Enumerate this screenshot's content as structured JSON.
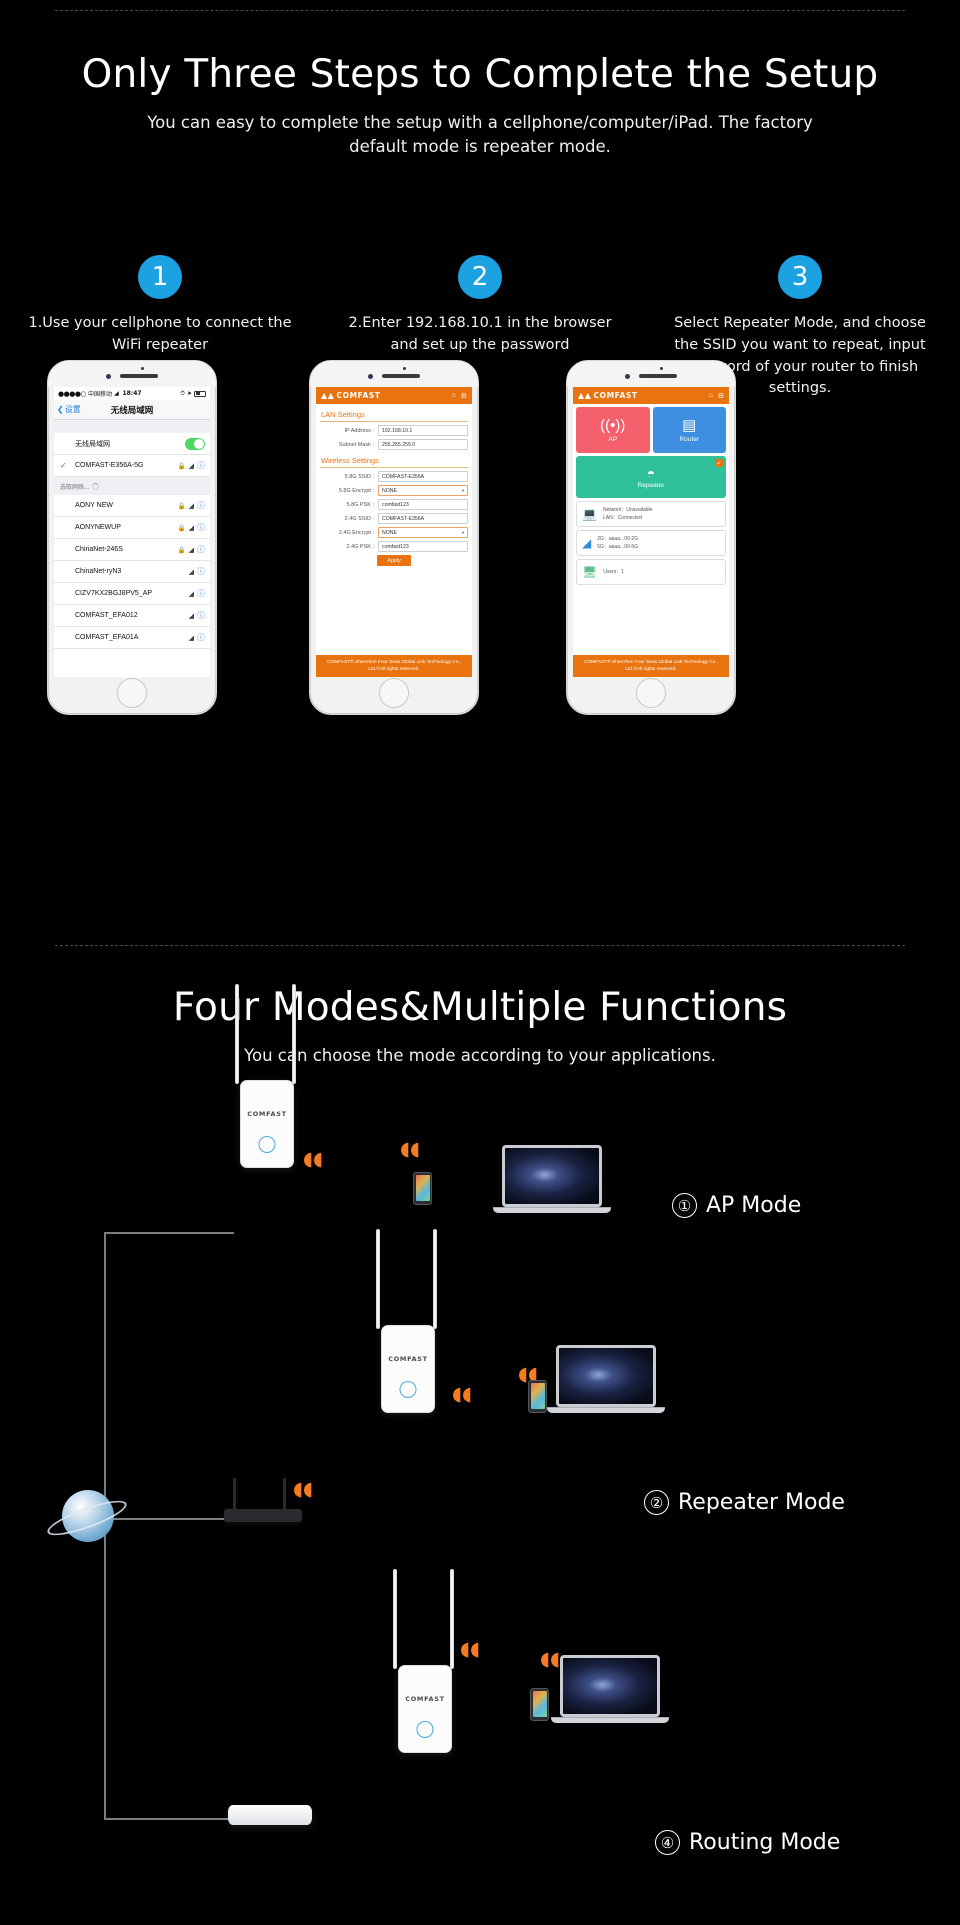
{
  "hero": {
    "title": "Only Three Steps to Complete the Setup",
    "subtitle": "You can easy to complete the setup with a cellphone/computer/iPad. The factory default mode is repeater mode."
  },
  "steps": [
    {
      "badge": "1",
      "text": "1.Use your cellphone to connect the WiFi repeater"
    },
    {
      "badge": "2",
      "text": "2.Enter 192.168.10.1 in the browser and set up the password"
    },
    {
      "badge": "3",
      "text": "Select Repeater Mode, and choose the SSID you want to repeat, input password of your router to finish settings."
    }
  ],
  "phone1": {
    "status": {
      "dots": "●●●●○",
      "carrier": "中国移动",
      "wifi_icon": "wifi-icon",
      "time": "18:47",
      "alarm_icon": "alarm-icon",
      "location_icon": "location-icon",
      "battery": "40%"
    },
    "nav": {
      "back": "设置",
      "title": "无线局域网"
    },
    "toggle_row": {
      "label": "无线局域网",
      "state": "on"
    },
    "connected": {
      "name": "COMFAST-E356A-5G",
      "checked": "✓"
    },
    "section_header": "选取网络...",
    "networks": [
      {
        "name": "AONY NEW",
        "locked": true
      },
      {
        "name": "AONYNEWUP",
        "locked": true
      },
      {
        "name": "ChinaNet-246S",
        "locked": true
      },
      {
        "name": "ChinaNet-ryN3",
        "locked": false
      },
      {
        "name": "CIZV7KX2BGJ8PV5_AP",
        "locked": false
      },
      {
        "name": "COMFAST_EFA012",
        "locked": false
      },
      {
        "name": "COMFAST_EFA01A",
        "locked": false
      }
    ]
  },
  "phone2": {
    "brand": "COMFAST",
    "header_icons": [
      "home-icon",
      "gear-icon"
    ],
    "lan_section": "LAN Settings",
    "lan_fields": [
      {
        "label": "IP Address :",
        "value": "192.168.10.1"
      },
      {
        "label": "Subnet Mask :",
        "value": "255.255.255.0"
      }
    ],
    "wireless_section": "Wireless Settings",
    "wireless_fields": [
      {
        "label": "5.8G SSID :",
        "value": "COMFAST-E356A",
        "type": "text"
      },
      {
        "label": "5.8G Encrypt :",
        "value": "NONE",
        "type": "select"
      },
      {
        "label": "5.8G PSK :",
        "value": "comfast123",
        "type": "text"
      },
      {
        "label": "2.4G SSID :",
        "value": "COMFAST-E356A",
        "type": "text"
      },
      {
        "label": "2.4G Encrypt :",
        "value": "NONE",
        "type": "select"
      },
      {
        "label": "2.4G PSK :",
        "value": "comfast123",
        "type": "text"
      }
    ],
    "apply": "Apply",
    "footer": "COMFAST® Shenzhen Four Seas Global Link Technology Co., Ltd.©All rights reserved."
  },
  "phone3": {
    "brand": "COMFAST",
    "header_icons": [
      "home-icon",
      "gear-icon"
    ],
    "tiles": [
      {
        "label": "AP",
        "icon": "ap-signal-icon",
        "color": "#f4606c"
      },
      {
        "label": "Router",
        "icon": "router-icon",
        "color": "#3e8fe0"
      }
    ],
    "repeater_tile": {
      "label": "Repeater",
      "icon": "repeater-icon",
      "color": "#2fc09a",
      "badge": "✓"
    },
    "info_cards": [
      {
        "icon": "network-status-icon",
        "lines": [
          "Network：Unavailable",
          "LAN：Connected"
        ]
      },
      {
        "icon": "wifi-icon",
        "lines": [
          "2G：aaaa...00-2G",
          "5G：aaaa...00-5G"
        ]
      },
      {
        "icon": "users-icon",
        "lines": [
          "Users：1"
        ]
      }
    ],
    "footer": "COMFAST® Shenzhen Four Seas Global Link Technology Co., Ltd.©All rights reserved."
  },
  "modes": {
    "title": "Four Modes&Multiple Functions",
    "subtitle": "You can choose the mode according to your applications.",
    "items": [
      {
        "num": "①",
        "label": "AP Mode"
      },
      {
        "num": "②",
        "label": "Repeater Mode"
      },
      {
        "num": "④",
        "label": "Routing Mode"
      }
    ],
    "device_brand": "COMFAST"
  },
  "colors": {
    "accent_blue": "#1ca2e0",
    "brand_orange": "#e8730f",
    "signal_orange": "#f47b20",
    "background": "#000000"
  }
}
